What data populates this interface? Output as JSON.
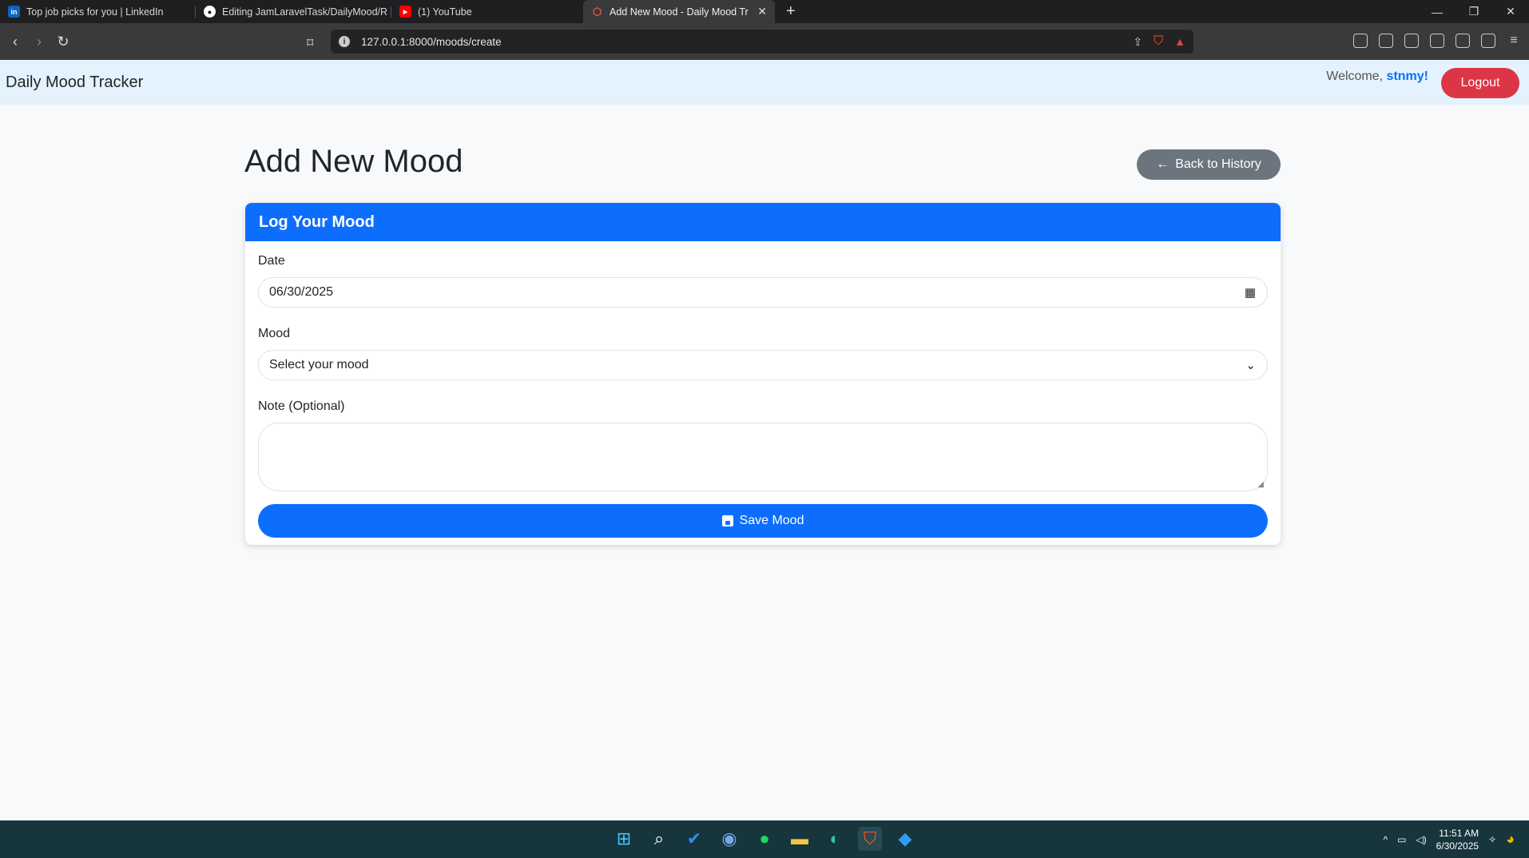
{
  "browser": {
    "tabs": [
      {
        "title": "Top job picks for you | LinkedIn",
        "icon": "linkedin-icon",
        "active": false
      },
      {
        "title": "Editing JamLaravelTask/DailyMood/R",
        "icon": "github-icon",
        "active": false
      },
      {
        "title": "(1) YouTube",
        "icon": "youtube-icon",
        "active": false
      },
      {
        "title": "Add New Mood - Daily Mood Tr",
        "icon": "laravel-icon",
        "active": true
      }
    ],
    "new_tab_label": "+",
    "url": "127.0.0.1:8000/moods/create"
  },
  "navbar": {
    "brand": "Daily Mood Tracker",
    "welcome_prefix": "Welcome, ",
    "username": "stnmy!",
    "logout_label": "Logout"
  },
  "page": {
    "title": "Add New Mood",
    "back_label": "Back to History"
  },
  "form": {
    "header": "Log Your Mood",
    "date_label": "Date",
    "date_value": "06/30/2025",
    "mood_label": "Mood",
    "mood_selected": "Select your mood",
    "note_label": "Note (Optional)",
    "note_value": "",
    "save_label": "Save Mood"
  },
  "taskbar": {
    "time": "11:51 AM",
    "date": "6/30/2025"
  },
  "colors": {
    "primary": "#0d6efd",
    "danger": "#dc3545",
    "secondary": "#6c757d",
    "navbar_bg": "#e3f2fd"
  }
}
